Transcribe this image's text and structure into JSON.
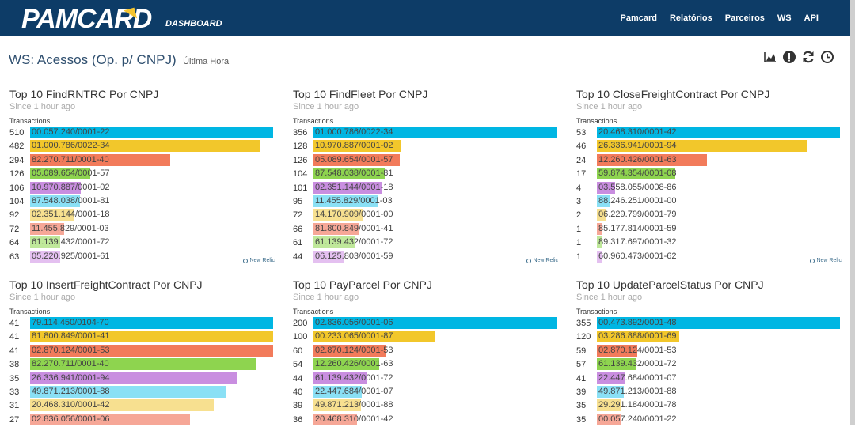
{
  "brand": {
    "name": "PAMCARD",
    "sub": "DASHBOARD"
  },
  "nav": [
    "Pamcard",
    "Relatórios",
    "Parceiros",
    "WS",
    "API"
  ],
  "page": {
    "title": "WS: Acessos (Op. p/ CNPJ)",
    "subtitle": "Última Hora"
  },
  "toolbar": {
    "icons": [
      "area-chart-icon",
      "alert-icon",
      "refresh-icon",
      "clock-icon"
    ]
  },
  "colors": [
    "#00b6e3",
    "#f2c72b",
    "#f27b5b",
    "#8ed44f",
    "#c98ee0",
    "#8ae0f5",
    "#f7e090",
    "#f6a797",
    "#bfe89a",
    "#e4c0f0"
  ],
  "panels": [
    {
      "title": "Top 10 FindRNTRC Por CNPJ",
      "since": "Since 1 hour ago",
      "unit": "Transactions",
      "badge": "New Relic",
      "rows": [
        {
          "value": "510",
          "label": "00.057.240/0001-22",
          "pct": 1.0
        },
        {
          "value": "482",
          "label": "01.000.786/0022-34",
          "pct": 0.945
        },
        {
          "value": "294",
          "label": "82.270.711/0001-40",
          "pct": 0.576
        },
        {
          "value": "126",
          "label": "05.089.654/0001-57",
          "pct": 0.247
        },
        {
          "value": "106",
          "label": "10.970.887/0001-02",
          "pct": 0.208
        },
        {
          "value": "104",
          "label": "87.548.038/0001-81",
          "pct": 0.204
        },
        {
          "value": "92",
          "label": "02.351.144/0001-18",
          "pct": 0.18
        },
        {
          "value": "72",
          "label": "11.455.829/0001-03",
          "pct": 0.141
        },
        {
          "value": "64",
          "label": "61.139.432/0001-72",
          "pct": 0.125
        },
        {
          "value": "63",
          "label": "05.220.925/0001-61",
          "pct": 0.124
        }
      ]
    },
    {
      "title": "Top 10 FindFleet Por CNPJ",
      "since": "Since 1 hour ago",
      "unit": "Transactions",
      "badge": "New Relic",
      "rows": [
        {
          "value": "356",
          "label": "01.000.786/0022-34",
          "pct": 1.0
        },
        {
          "value": "128",
          "label": "10.970.887/0001-02",
          "pct": 0.36
        },
        {
          "value": "126",
          "label": "05.089.654/0001-57",
          "pct": 0.354
        },
        {
          "value": "104",
          "label": "87.548.038/0001-81",
          "pct": 0.292
        },
        {
          "value": "101",
          "label": "02.351.144/0001-18",
          "pct": 0.284
        },
        {
          "value": "95",
          "label": "11.455.829/0001-03",
          "pct": 0.267
        },
        {
          "value": "72",
          "label": "14.170.909/0001-00",
          "pct": 0.202
        },
        {
          "value": "66",
          "label": "81.800.849/0001-41",
          "pct": 0.185
        },
        {
          "value": "61",
          "label": "61.139.432/0001-72",
          "pct": 0.171
        },
        {
          "value": "44",
          "label": "06.125.803/0001-59",
          "pct": 0.124
        }
      ]
    },
    {
      "title": "Top 10 CloseFreightContract Por CNPJ",
      "since": "Since 1 hour ago",
      "unit": "Transactions",
      "badge": "New Relic",
      "rows": [
        {
          "value": "53",
          "label": "20.468.310/0001-42",
          "pct": 1.0
        },
        {
          "value": "46",
          "label": "26.336.941/0001-94",
          "pct": 0.868
        },
        {
          "value": "24",
          "label": "12.260.426/0001-63",
          "pct": 0.453
        },
        {
          "value": "17",
          "label": "59.874.354/0001-08",
          "pct": 0.321
        },
        {
          "value": "4",
          "label": "03.558.055/0008-86",
          "pct": 0.075
        },
        {
          "value": "3",
          "label": "88.246.251/0001-00",
          "pct": 0.057
        },
        {
          "value": "2",
          "label": "06.229.799/0001-79",
          "pct": 0.038
        },
        {
          "value": "1",
          "label": "85.177.814/0001-59",
          "pct": 0.019
        },
        {
          "value": "1",
          "label": "89.317.697/0001-32",
          "pct": 0.019
        },
        {
          "value": "1",
          "label": "60.960.473/0001-62",
          "pct": 0.019
        }
      ]
    },
    {
      "title": "Top 10 InsertFreightContract Por CNPJ",
      "since": "Since 1 hour ago",
      "unit": "Transactions",
      "badge": "",
      "rows": [
        {
          "value": "41",
          "label": "79.114.450/0104-70",
          "pct": 1.0
        },
        {
          "value": "41",
          "label": "81.800.849/0001-41",
          "pct": 1.0
        },
        {
          "value": "41",
          "label": "02.870.124/0001-53",
          "pct": 1.0
        },
        {
          "value": "38",
          "label": "82.270.711/0001-40",
          "pct": 0.927
        },
        {
          "value": "35",
          "label": "26.336.941/0001-94",
          "pct": 0.854
        },
        {
          "value": "33",
          "label": "49.871.213/0001-88",
          "pct": 0.805
        },
        {
          "value": "31",
          "label": "20.468.310/0001-42",
          "pct": 0.756
        },
        {
          "value": "27",
          "label": "02.836.056/0001-06",
          "pct": 0.659
        }
      ]
    },
    {
      "title": "Top 10 PayParcel Por CNPJ",
      "since": "Since 1 hour ago",
      "unit": "Transactions",
      "badge": "",
      "rows": [
        {
          "value": "200",
          "label": "02.836.056/0001-06",
          "pct": 1.0
        },
        {
          "value": "100",
          "label": "00.233.065/0001-87",
          "pct": 0.5
        },
        {
          "value": "60",
          "label": "02.870.124/0001-53",
          "pct": 0.3
        },
        {
          "value": "54",
          "label": "12.260.426/0001-63",
          "pct": 0.27
        },
        {
          "value": "44",
          "label": "61.139.432/0001-72",
          "pct": 0.22
        },
        {
          "value": "40",
          "label": "22.447.684/0001-07",
          "pct": 0.2
        },
        {
          "value": "39",
          "label": "49.871.213/0001-88",
          "pct": 0.195
        },
        {
          "value": "36",
          "label": "20.468.310/0001-42",
          "pct": 0.18
        }
      ]
    },
    {
      "title": "Top 10 UpdateParcelStatus Por CNPJ",
      "since": "Since 1 hour ago",
      "unit": "Transactions",
      "badge": "",
      "rows": [
        {
          "value": "355",
          "label": "00.473.892/0001-48",
          "pct": 1.0
        },
        {
          "value": "120",
          "label": "03.286.888/0001-69",
          "pct": 0.338
        },
        {
          "value": "59",
          "label": "02.870.124/0001-53",
          "pct": 0.166
        },
        {
          "value": "57",
          "label": "61.139.432/0001-72",
          "pct": 0.161
        },
        {
          "value": "41",
          "label": "22.447.684/0001-07",
          "pct": 0.115
        },
        {
          "value": "39",
          "label": "49.871.213/0001-88",
          "pct": 0.11
        },
        {
          "value": "35",
          "label": "29.291.184/0001-78",
          "pct": 0.099
        },
        {
          "value": "35",
          "label": "00.057.240/0001-22",
          "pct": 0.099
        }
      ]
    }
  ]
}
